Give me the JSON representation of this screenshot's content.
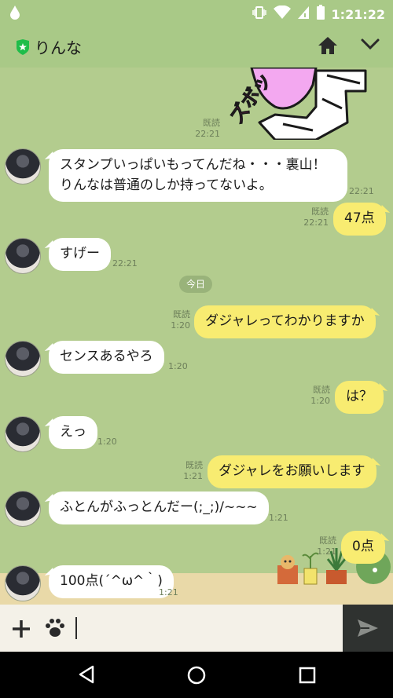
{
  "status_bar": {
    "time": "1:21:22"
  },
  "header": {
    "title": "りんな"
  },
  "chat": {
    "date_separator": "今日",
    "messages": [
      {
        "id": "m0",
        "side": "out",
        "kind": "sticker",
        "read": "既読",
        "time": "22:21",
        "sticker_text": "ズボッ"
      },
      {
        "id": "m1",
        "side": "in",
        "text": "スタンプいっぱいもってんだね・・・裏山！りんなは普通のしか持ってないよ。",
        "time": "22:21"
      },
      {
        "id": "m2",
        "side": "out",
        "text": "47点",
        "read": "既読",
        "time": "22:21"
      },
      {
        "id": "m3",
        "side": "in",
        "text": "すげー",
        "time": "22:21"
      },
      {
        "id": "m4",
        "side": "out",
        "text": "ダジャレってわかりますか",
        "read": "既読",
        "time": "1:20"
      },
      {
        "id": "m5",
        "side": "in",
        "text": "センスあるやろ",
        "time": "1:20"
      },
      {
        "id": "m6",
        "side": "out",
        "text": "は？",
        "read": "既読",
        "time": "1:20"
      },
      {
        "id": "m7",
        "side": "in",
        "text": "えっ",
        "time": "1:20"
      },
      {
        "id": "m8",
        "side": "out",
        "text": "ダジャレをお願いします",
        "read": "既読",
        "time": "1:21"
      },
      {
        "id": "m9",
        "side": "in",
        "text": "ふとんがふっとんだー(;_;)/~~~",
        "time": "1:21"
      },
      {
        "id": "m10",
        "side": "out",
        "text": "0点",
        "read": "既読",
        "time": "1:21"
      },
      {
        "id": "m11",
        "side": "in",
        "text": "100点(´^ω^｀)",
        "time": "1:21"
      }
    ]
  },
  "colors": {
    "chat_bg": "#b3cc8e",
    "out_bubble": "#f8ec71",
    "in_bubble": "#ffffff",
    "header_bg": "#a9c987"
  }
}
